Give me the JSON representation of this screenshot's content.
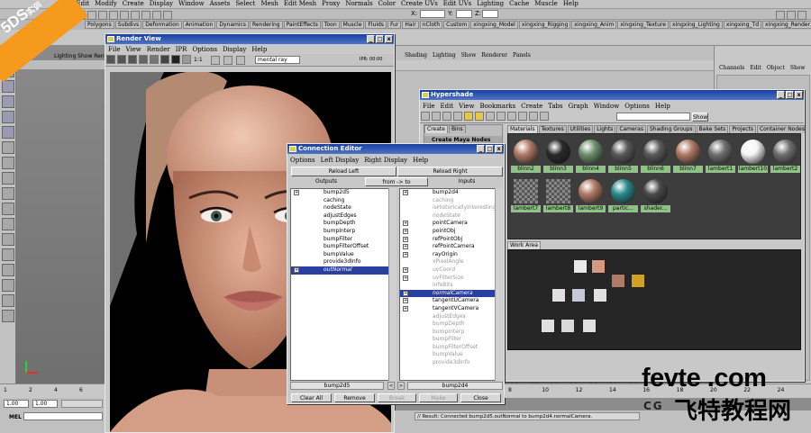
{
  "main_menu": [
    "File",
    "Edit",
    "Modify",
    "Create",
    "Display",
    "Window",
    "Assets",
    "Select",
    "Mesh",
    "Edit Mesh",
    "Proxy",
    "Normals",
    "Color",
    "Create UVs",
    "Edit UVs",
    "Lighting",
    "Cache",
    "Muscle",
    "Help"
  ],
  "coord_labels": {
    "x": "X:",
    "y": "Y:",
    "z": "Z:"
  },
  "shelf_tabs": [
    "Polygons",
    "Subdivs",
    "Deformation",
    "Animation",
    "Dynamics",
    "Rendering",
    "PaintEffects",
    "Toon",
    "Muscle",
    "Fluids",
    "Fur",
    "Hair",
    "nCloth",
    "Custom",
    "xingxing_Model",
    "xingxing_Rigging",
    "xingxing_Anim",
    "xingxing_Texture",
    "xingxing_Lighting",
    "xingxing_Td",
    "xingxing_Render",
    "xingxing_Effect"
  ],
  "shelf_active": 21,
  "viewport_menu": "Lighting  Show  Ren",
  "render_view": {
    "title": "Render View",
    "menu": [
      "File",
      "View",
      "Render",
      "IPR",
      "Options",
      "Display",
      "Help"
    ],
    "renderer": "mental ray",
    "ratio": "1:1",
    "status": "IPR: 00:00"
  },
  "bg_panel_menu": [
    "Shading",
    "Lighting",
    "Show",
    "Renderer",
    "Panels"
  ],
  "channel_box_menu": [
    "Channels",
    "Edit",
    "Object",
    "Show"
  ],
  "hypershade": {
    "title": "Hypershade",
    "menu": [
      "File",
      "Edit",
      "View",
      "Bookmarks",
      "Create",
      "Tabs",
      "Graph",
      "Window",
      "Options",
      "Help"
    ],
    "show_label": "Show",
    "left_tabs": [
      "Create",
      "Bins"
    ],
    "create_header": "Create Maya Nodes",
    "tabs": [
      "Materials",
      "Textures",
      "Utilities",
      "Lights",
      "Cameras",
      "Shading Groups",
      "Bake Sets",
      "Projects",
      "Container Nodes"
    ],
    "materials": [
      "blinn2",
      "blinn3",
      "blinn4",
      "blinn5",
      "blinn6",
      "blinn7",
      "lambert1",
      "lambert10",
      "lambert2",
      "lambert7",
      "lambert8",
      "lambert9",
      "partic...",
      "shader..."
    ],
    "work_area": "Work Area"
  },
  "connection_editor": {
    "title": "Connection Editor",
    "menu": [
      "Options",
      "Left Display",
      "Right Display",
      "Help"
    ],
    "reload_left": "Reload Left",
    "reload_right": "Reload Right",
    "outputs": "Outputs",
    "direction": "from -> to",
    "inputs": "Inputs",
    "left_items": [
      {
        "label": "bump2d5",
        "plus": true,
        "style": "normal"
      },
      {
        "label": "caching",
        "plus": false,
        "style": "normal"
      },
      {
        "label": "nodeState",
        "plus": false,
        "style": "normal"
      },
      {
        "label": "adjustEdges",
        "plus": false,
        "style": "normal"
      },
      {
        "label": "bumpDepth",
        "plus": false,
        "style": "normal"
      },
      {
        "label": "bumpInterp",
        "plus": false,
        "style": "normal"
      },
      {
        "label": "bumpFilter",
        "plus": false,
        "style": "normal"
      },
      {
        "label": "bumpFilterOffset",
        "plus": false,
        "style": "normal"
      },
      {
        "label": "bumpValue",
        "plus": false,
        "style": "normal"
      },
      {
        "label": "provide3dInfo",
        "plus": false,
        "style": "normal"
      },
      {
        "label": "outNormal",
        "plus": true,
        "style": "sel"
      }
    ],
    "right_items": [
      {
        "label": "bump2d4",
        "plus": true,
        "style": "normal"
      },
      {
        "label": "caching",
        "plus": false,
        "style": "gray"
      },
      {
        "label": "isHistoricallyInteresting",
        "plus": false,
        "style": "gray"
      },
      {
        "label": "nodeState",
        "plus": false,
        "style": "gray"
      },
      {
        "label": "pointCamera",
        "plus": true,
        "style": "normal"
      },
      {
        "label": "pointObj",
        "plus": true,
        "style": "normal"
      },
      {
        "label": "refPointObj",
        "plus": true,
        "style": "normal"
      },
      {
        "label": "refPointCamera",
        "plus": true,
        "style": "normal"
      },
      {
        "label": "rayOrigin",
        "plus": true,
        "style": "normal"
      },
      {
        "label": "xPixelAngle",
        "plus": false,
        "style": "gray"
      },
      {
        "label": "uvCoord",
        "plus": true,
        "style": "gray"
      },
      {
        "label": "uvFilterSize",
        "plus": true,
        "style": "gray"
      },
      {
        "label": "infoBits",
        "plus": false,
        "style": "gray"
      },
      {
        "label": "normalCamera",
        "plus": true,
        "style": "sel"
      },
      {
        "label": "tangentUCamera",
        "plus": true,
        "style": "normal"
      },
      {
        "label": "tangentVCamera",
        "plus": true,
        "style": "normal"
      },
      {
        "label": "adjustEdges",
        "plus": false,
        "style": "gray"
      },
      {
        "label": "bumpDepth",
        "plus": false,
        "style": "gray"
      },
      {
        "label": "bumpInterp",
        "plus": false,
        "style": "gray"
      },
      {
        "label": "bumpFilter",
        "plus": false,
        "style": "gray"
      },
      {
        "label": "bumpFilterOffset",
        "plus": false,
        "style": "gray"
      },
      {
        "label": "bumpValue",
        "plus": false,
        "style": "gray"
      },
      {
        "label": "provide3dInfo",
        "plus": false,
        "style": "gray"
      }
    ],
    "left_node": "bump2d5",
    "right_node": "bump2d4",
    "buttons": [
      "Clear All",
      "Remove",
      "Break",
      "Make",
      "Close"
    ]
  },
  "timeline": {
    "ticks": [
      "1",
      "2",
      "4",
      "6",
      "8",
      "10",
      "12",
      "14",
      "16",
      "18",
      "20",
      "22",
      "24"
    ],
    "start": "1.00",
    "current": "1.00",
    "mel": "MEL"
  },
  "command_result": "// Result: Connected bump2d5.outNormal to bump2d4.normalCamera.",
  "watermarks": {
    "top_left_brand": "5DS",
    "top_left_cn": "实训",
    "site": "fevte .com",
    "site_cn": "飞特教程网",
    "cg": "CG"
  },
  "colors": {
    "title_bar": "#2a4fb0",
    "selection": "#2a3f9e",
    "material_label": "#90c288",
    "orange_badge": "#f59a1c"
  }
}
